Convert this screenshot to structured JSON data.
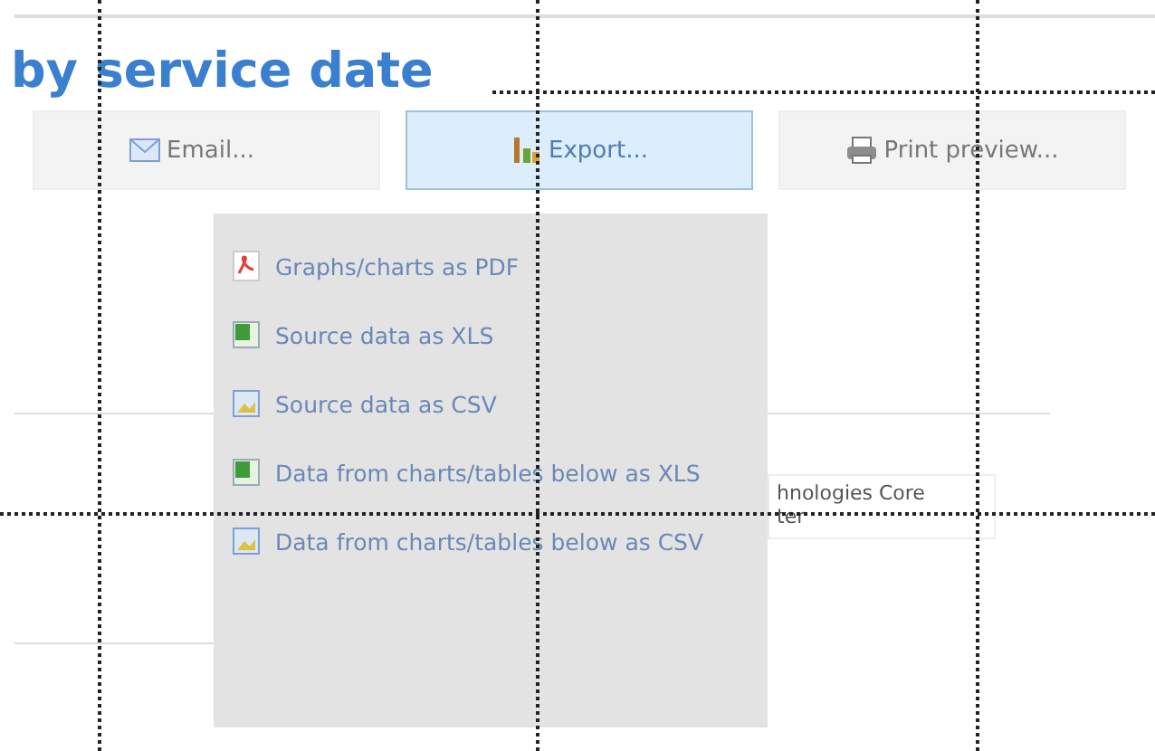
{
  "title": "by service date",
  "toolbar": [
    {
      "label": "Email...",
      "kind": "email",
      "selected": false
    },
    {
      "label": "Export...",
      "kind": "export",
      "selected": true
    },
    {
      "label": "Print preview...",
      "kind": "print",
      "selected": false
    }
  ],
  "export_menu": [
    {
      "label": "Graphs/charts as PDF",
      "kind": "pdf"
    },
    {
      "label": "Source data as XLS",
      "kind": "xls"
    },
    {
      "label": "Source data as CSV",
      "kind": "csv"
    },
    {
      "label": "Data from charts/tables below as XLS",
      "kind": "xls"
    },
    {
      "label": "Data from charts/tables below as CSV",
      "kind": "csv"
    }
  ],
  "background_label": {
    "lines": [
      "hnologies Core",
      "ter"
    ]
  }
}
